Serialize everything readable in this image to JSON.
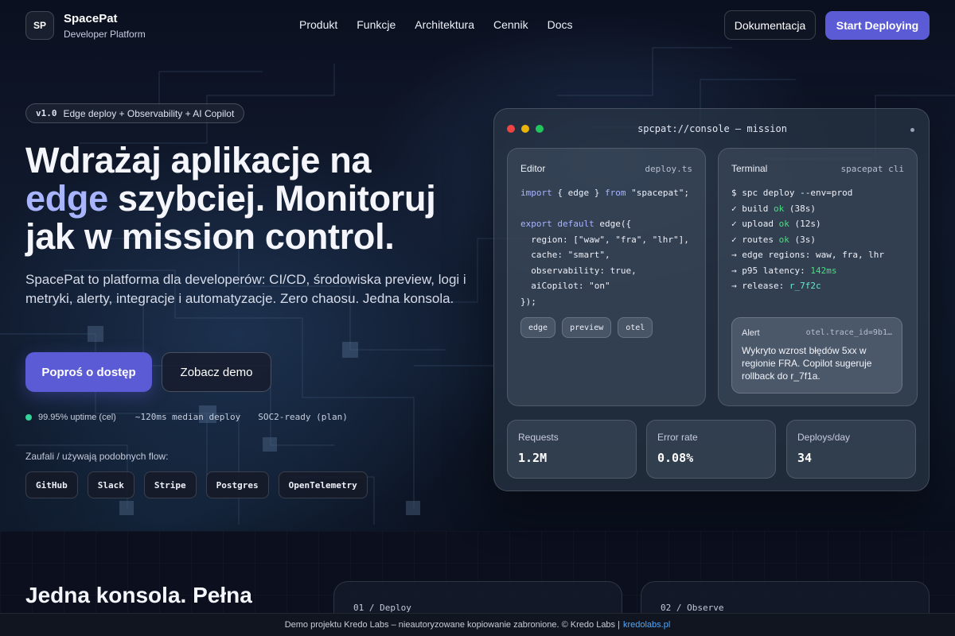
{
  "brand": {
    "logo_text": "SP",
    "name": "SpacePat",
    "subtitle": "Developer Platform"
  },
  "nav": {
    "links": [
      "Produkt",
      "Funkcje",
      "Architektura",
      "Cennik",
      "Docs"
    ]
  },
  "header_buttons": {
    "docs": "Dokumentacja",
    "deploy": "Start Deploying"
  },
  "hero": {
    "badge_version": "v1.0",
    "badge_text": "Edge deploy + Observability + AI Copilot",
    "headline_line1": "Wdrażaj aplikacje na",
    "headline_accent": "edge",
    "headline_line2": " szybciej. Monitoruj",
    "headline_line3": "jak w mission control.",
    "lead": "SpacePat to platforma dla developerów: CI/CD, środowiska preview, logi i metryki, alerty, integracje i automatyzacje. Zero chaosu. Jedna konsola.",
    "cta_primary": "Poproś o dostęp",
    "cta_secondary": "Zobacz demo",
    "stats": [
      "99.95% uptime (cel)",
      "~120ms median deploy",
      "SOC2-ready (plan)"
    ],
    "trusted_label": "Zaufali / używają podobnych flow:",
    "trusted_chips": [
      "GitHub",
      "Slack",
      "Stripe",
      "Postgres",
      "OpenTelemetry"
    ]
  },
  "console": {
    "title": "spcpat://console — mission",
    "editor": {
      "title": "Editor",
      "file": "deploy.ts",
      "lines": {
        "l1_kw1": "import",
        "l1_mid": " { edge } ",
        "l1_kw2": "from",
        "l1_str": " \"spacepat\";",
        "l3_kw": "export default",
        "l3_rest": " edge({",
        "l4": "  region: [\"waw\", \"fra\", \"lhr\"],",
        "l5": "  cache: \"smart\",",
        "l6": "  observability: true,",
        "l7": "  aiCopilot: \"on\"",
        "l8": "});"
      },
      "tags": [
        "edge",
        "preview",
        "otel"
      ]
    },
    "terminal": {
      "title": "Terminal",
      "file": "spacepat cli",
      "prompt": "$ spc deploy --env=prod",
      "build_prefix": "✓ build ",
      "build_ok": "ok",
      "build_time": " (38s)",
      "upload_prefix": "✓ upload ",
      "upload_ok": "ok",
      "upload_time": " (12s)",
      "routes_prefix": "✓ routes ",
      "routes_ok": "ok",
      "routes_time": " (3s)",
      "regions": "→ edge regions: waw, fra, lhr",
      "latency_prefix": "→ p95 latency: ",
      "latency_value": "142ms",
      "release_prefix": "→ release: ",
      "release_value": "r_7f2c"
    },
    "alert": {
      "title": "Alert",
      "trace": "otel.trace_id=9b1…",
      "body": "Wykryto wzrost błędów 5xx w regionie FRA. Copilot sugeruje rollback do r_7f1a."
    },
    "metrics": [
      {
        "label": "Requests",
        "value": "1.2M"
      },
      {
        "label": "Error rate",
        "value": "0.08%"
      },
      {
        "label": "Deploys/day",
        "value": "34"
      }
    ]
  },
  "section": {
    "title": "Jedna konsola. Pełna",
    "steps": [
      "01 / Deploy",
      "02 / Observe"
    ]
  },
  "footer": {
    "text": "Demo projektu Kredo Labs – nieautoryzowane kopiowanie zabronione. © Kredo Labs |",
    "link": "kredolabs.pl"
  },
  "colors": {
    "accent": "#5b5bd6",
    "accent_text": "#a9b4ff",
    "success": "#34d399",
    "link": "#4ea8ff"
  }
}
